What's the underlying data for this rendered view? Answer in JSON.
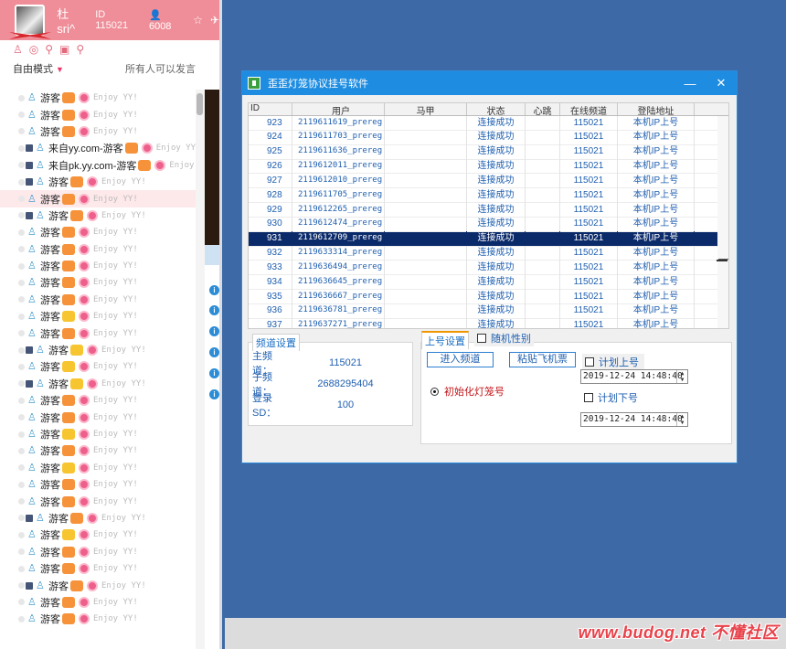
{
  "yy": {
    "username": "杜sri^",
    "id_text": "ID 115021",
    "user_count": "6008",
    "mode": "自由模式",
    "speak": "所有人可以发言"
  },
  "list": [
    {
      "dev": "",
      "name": "游客",
      "kind": "r",
      "crown": false
    },
    {
      "dev": "",
      "name": "游客",
      "kind": "r",
      "crown": false
    },
    {
      "dev": "",
      "name": "游客",
      "kind": "r",
      "crown": false
    },
    {
      "dev": "y",
      "name": "来自yy.com-游客",
      "kind": "r",
      "crown": false
    },
    {
      "dev": "p",
      "name": "来自pk.yy.com-游客",
      "kind": "r",
      "crown": false
    },
    {
      "dev": "m",
      "name": "游客",
      "kind": "r",
      "crown": false
    },
    {
      "dev": "",
      "name": "游客",
      "kind": "r",
      "crown": false,
      "sel": true
    },
    {
      "dev": "d",
      "name": "游客",
      "kind": "r",
      "crown": false
    },
    {
      "dev": "",
      "name": "游客",
      "kind": "r",
      "crown": false
    },
    {
      "dev": "",
      "name": "游客",
      "kind": "r",
      "crown": false
    },
    {
      "dev": "",
      "name": "游客",
      "kind": "r",
      "crown": false
    },
    {
      "dev": "",
      "name": "游客",
      "kind": "r",
      "crown": false
    },
    {
      "dev": "",
      "name": "游客",
      "kind": "r",
      "crown": false
    },
    {
      "dev": "",
      "name": "游客",
      "kind": "r",
      "crown": true
    },
    {
      "dev": "",
      "name": "游客",
      "kind": "r",
      "crown": false
    },
    {
      "dev": "m",
      "name": "游客",
      "kind": "r",
      "crown": true
    },
    {
      "dev": "",
      "name": "游客",
      "kind": "r",
      "crown": true
    },
    {
      "dev": "d",
      "name": "游客",
      "kind": "r",
      "crown": true
    },
    {
      "dev": "",
      "name": "游客",
      "kind": "r",
      "crown": false
    },
    {
      "dev": "",
      "name": "游客",
      "kind": "r",
      "crown": false
    },
    {
      "dev": "",
      "name": "游客",
      "kind": "r",
      "crown": true
    },
    {
      "dev": "",
      "name": "游客",
      "kind": "r",
      "crown": false
    },
    {
      "dev": "",
      "name": "游客",
      "kind": "r",
      "crown": true
    },
    {
      "dev": "",
      "name": "游客",
      "kind": "r",
      "crown": false
    },
    {
      "dev": "",
      "name": "游客",
      "kind": "r",
      "crown": false
    },
    {
      "dev": "m",
      "name": "游客",
      "kind": "r",
      "crown": false
    },
    {
      "dev": "",
      "name": "游客",
      "kind": "r",
      "crown": true
    },
    {
      "dev": "",
      "name": "游客",
      "kind": "r",
      "crown": false
    },
    {
      "dev": "",
      "name": "游客",
      "kind": "r",
      "crown": false
    },
    {
      "dev": "d",
      "name": "游客",
      "kind": "r",
      "crown": false
    },
    {
      "dev": "",
      "name": "游客",
      "kind": "r",
      "crown": false
    },
    {
      "dev": "",
      "name": "游客",
      "kind": "r",
      "crown": false
    }
  ],
  "enjoy": "Enjoy YY!",
  "enjoy_short": "Enjoy YY",
  "enjoy_cut": "Enjoy",
  "app": {
    "title": "歪歪灯笼协议挂号软件",
    "minimize": "—",
    "close": "✕"
  },
  "grid": {
    "headers": [
      "ID",
      "用户",
      "马甲",
      "状态",
      "心跳",
      "在线频道",
      "登陆地址"
    ],
    "rows": [
      [
        "923",
        "2119611619_prereg",
        "",
        "连接成功",
        "",
        "115021",
        "本机IP上号"
      ],
      [
        "924",
        "2119611703_prereg",
        "",
        "连接成功",
        "",
        "115021",
        "本机IP上号"
      ],
      [
        "925",
        "2119611636_prereg",
        "",
        "连接成功",
        "",
        "115021",
        "本机IP上号"
      ],
      [
        "926",
        "2119612011_prereg",
        "",
        "连接成功",
        "",
        "115021",
        "本机IP上号"
      ],
      [
        "927",
        "2119612010_prereg",
        "",
        "连接成功",
        "",
        "115021",
        "本机IP上号"
      ],
      [
        "928",
        "2119611705_prereg",
        "",
        "连接成功",
        "",
        "115021",
        "本机IP上号"
      ],
      [
        "929",
        "2119612265_prereg",
        "",
        "连接成功",
        "",
        "115021",
        "本机IP上号"
      ],
      [
        "930",
        "2119612474_prereg",
        "",
        "连接成功",
        "",
        "115021",
        "本机IP上号"
      ],
      [
        "931",
        "2119612709_prereg",
        "",
        "连接成功",
        "",
        "115021",
        "本机IP上号"
      ],
      [
        "932",
        "2119633314_prereg",
        "",
        "连接成功",
        "",
        "115021",
        "本机IP上号"
      ],
      [
        "933",
        "2119636494_prereg",
        "",
        "连接成功",
        "",
        "115021",
        "本机IP上号"
      ],
      [
        "934",
        "2119636645_prereg",
        "",
        "连接成功",
        "",
        "115021",
        "本机IP上号"
      ],
      [
        "935",
        "2119636667_prereg",
        "",
        "连接成功",
        "",
        "115021",
        "本机IP上号"
      ],
      [
        "936",
        "2119636781_prereg",
        "",
        "连接成功",
        "",
        "115021",
        "本机IP上号"
      ],
      [
        "937",
        "2119637271_prereg",
        "",
        "连接成功",
        "",
        "115021",
        "本机IP上号"
      ]
    ],
    "selected_index": 8
  },
  "channel": {
    "tab": "频道设置",
    "main_label": "主频道：",
    "main_value": "115021",
    "sub_label": "子频道：",
    "sub_value": "2688295404",
    "sd_label": "登录SD：",
    "sd_value": "100"
  },
  "login": {
    "tab": "上号设置",
    "random_gender": "随机性别",
    "enter_channel": "进入频道",
    "paste_ticket": "粘贴飞机票",
    "init_lantern": "初始化灯笼号",
    "plan_on": "计划上号",
    "plan_off": "计划下号",
    "dt_on": "2019-12-24 14:48:40",
    "dt_off": "2019-12-24 14:48:40"
  },
  "watermark": "www.budog.net 不懂社区"
}
